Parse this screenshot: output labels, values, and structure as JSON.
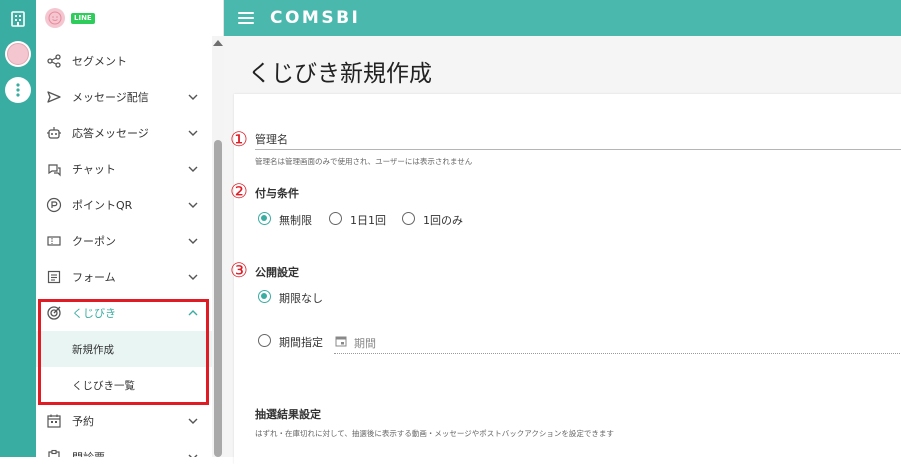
{
  "rail": {
    "icons": [
      "building-icon",
      "avatar-icon",
      "more-vertical-icon"
    ]
  },
  "sidebar": {
    "line_badge": "LINE",
    "items": [
      {
        "label": "セグメント",
        "icon": "share-icon"
      },
      {
        "label": "メッセージ配信",
        "icon": "send-icon"
      },
      {
        "label": "応答メッセージ",
        "icon": "robot-icon"
      },
      {
        "label": "チャット",
        "icon": "chat-icon"
      },
      {
        "label": "ポイントQR",
        "icon": "point-icon"
      },
      {
        "label": "クーポン",
        "icon": "coupon-icon"
      },
      {
        "label": "フォーム",
        "icon": "form-icon"
      },
      {
        "label": "くじびき",
        "icon": "target-icon"
      },
      {
        "label": "予約",
        "icon": "calendar-icon"
      },
      {
        "label": "問診票",
        "icon": "clipboard-icon"
      }
    ],
    "sub_items": [
      "新規作成",
      "くじびき一覧"
    ]
  },
  "header": {
    "logo": "COMSBI"
  },
  "main": {
    "title": "くじびき新規作成",
    "annotations": [
      "①",
      "②",
      "③"
    ],
    "management_name": {
      "label": "管理名",
      "hint": "管理名は管理画面のみで使用され、ユーザーには表示されません"
    },
    "grant_condition": {
      "label": "付与条件",
      "options": [
        "無制限",
        "1日1回",
        "1回のみ"
      ],
      "selected": "無制限"
    },
    "publish": {
      "label": "公開設定",
      "options": [
        "期限なし",
        "期間指定"
      ],
      "selected": "期限なし",
      "period_placeholder": "期間"
    },
    "lottery_result": {
      "label": "抽選結果設定",
      "hint": "はずれ・在庫切れに対して、抽選後に表示する動画・メッセージやポストバックアクションを設定できます"
    }
  },
  "colors": {
    "accent": "#3aada2",
    "header": "#4bb8ae",
    "annotation": "#e01b24"
  }
}
